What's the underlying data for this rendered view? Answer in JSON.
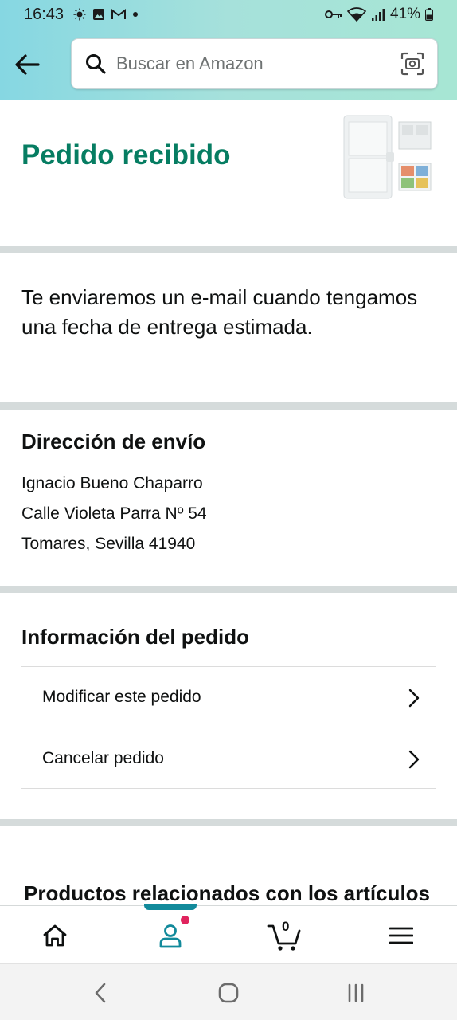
{
  "status_bar": {
    "time": "16:43",
    "battery": "41%"
  },
  "search": {
    "placeholder": "Buscar en Amazon"
  },
  "order": {
    "title": "Pedido recibido",
    "message": "Te enviaremos un e-mail cuando tengamos una fecha de entrega estimada."
  },
  "shipping": {
    "title": "Dirección de envío",
    "name": "Ignacio Bueno Chaparro",
    "street": "Calle Violeta Parra Nº 54",
    "city": "Tomares, Sevilla 41940"
  },
  "order_info": {
    "title": "Información del pedido",
    "items": [
      {
        "label": "Modificar este pedido"
      },
      {
        "label": "Cancelar pedido"
      }
    ]
  },
  "related": {
    "title": "Productos relacionados con los artículos"
  },
  "bottom_nav": {
    "cart_count": "0",
    "active": "account"
  },
  "colors": {
    "header_gradient_start": "#86d7e2",
    "header_gradient_end": "#a7e6d4",
    "title_green": "#067d62",
    "active_tab": "#128a9b",
    "notification_dot": "#e0245e",
    "divider": "#d5dbdb"
  },
  "icons": [
    "back-arrow-icon",
    "search-icon",
    "camera-icon",
    "chevron-right-icon",
    "home-icon",
    "account-icon",
    "cart-icon",
    "menu-icon"
  ]
}
